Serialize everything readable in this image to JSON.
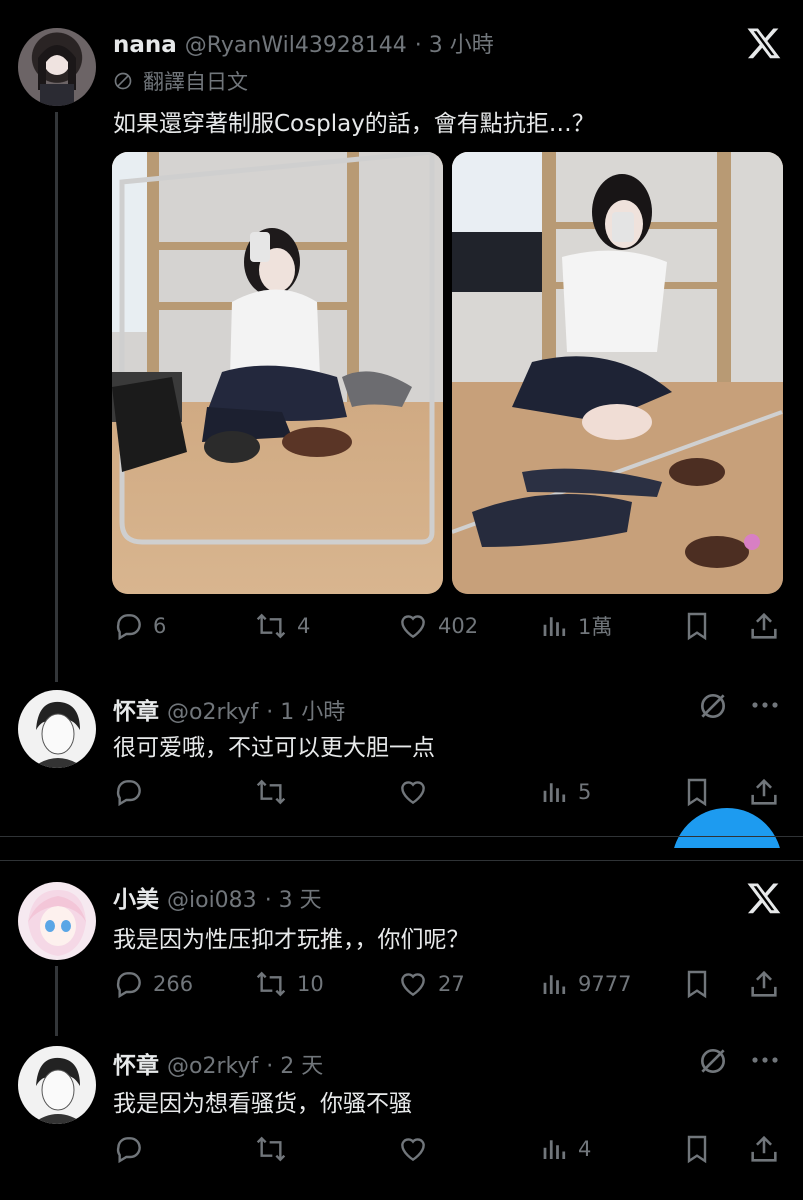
{
  "tweet1": {
    "name": "nana",
    "handle": "@RyanWil43928144",
    "time": "· 3 小時",
    "translated": "翻譯自日文",
    "text": "如果還穿著制服Cosplay的話，會有點抗拒…？",
    "replies": "6",
    "reposts": "4",
    "likes": "402",
    "views": "1萬"
  },
  "reply1": {
    "name": "怀章",
    "handle": "@o2rkyf",
    "time": "· 1 小時",
    "text": "很可爱哦，不过可以更大胆一点",
    "views": "5"
  },
  "tweet2": {
    "name": "小美",
    "handle": "@ioi083",
    "time": "· 3 天",
    "text": "我是因为性压抑才玩推，，你们呢？",
    "replies": "266",
    "reposts": "10",
    "likes": "27",
    "views": "9777"
  },
  "reply2": {
    "name": "怀章",
    "handle": "@o2rkyf",
    "time": "· 2 天",
    "text": "我是因为想看骚货，你骚不骚",
    "views": "4"
  },
  "colors": {
    "background": "#000000",
    "text": "#e7e9ea",
    "muted": "#71767b",
    "accent": "#1d9bf0"
  },
  "icons": [
    "x-logo-icon",
    "translate-icon",
    "reply-icon",
    "repost-icon",
    "like-icon",
    "views-icon",
    "bookmark-icon",
    "share-icon",
    "more-icon",
    "mute-icon"
  ]
}
